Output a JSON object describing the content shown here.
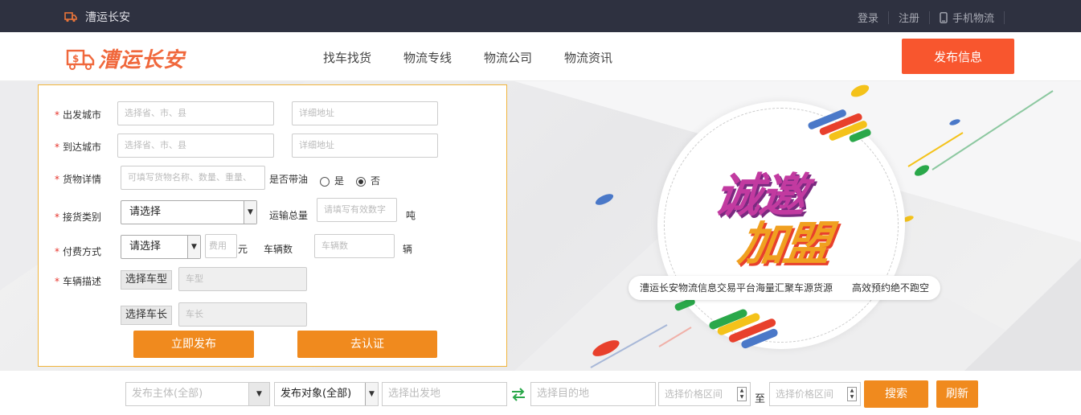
{
  "topbar": {
    "brand": "漕运长安",
    "login": "登录",
    "register": "注册",
    "mobile": "手机物流"
  },
  "header": {
    "logo_text": "漕运长安",
    "nav": [
      "找车找货",
      "物流专线",
      "物流公司",
      "物流资讯"
    ],
    "publish_button": "发布信息"
  },
  "form": {
    "depart_city_label": "出发城市",
    "arrive_city_label": "到达城市",
    "cargo_label": "货物详情",
    "receive_type_label": "接货类别",
    "payment_label": "付费方式",
    "vehicle_desc_label": "车辆描述",
    "region_placeholder": "选择省、市、县",
    "address_placeholder": "详细地址",
    "cargo_placeholder": "可填写货物名称、数量、重量、",
    "oil_label": "是否带油",
    "yes": "是",
    "no": "否",
    "oil_selected": "否",
    "receive_select": "请选择",
    "total_label": "运输总量",
    "total_placeholder": "请填写有效数字",
    "ton": "吨",
    "payment_select": "请选择",
    "fee_placeholder": "费用",
    "yuan": "元",
    "vehicle_count_label": "车辆数",
    "vehicle_count_placeholder": "车辆数",
    "vehicle_unit": "辆",
    "choose_type": "选择车型",
    "type_placeholder": "车型",
    "choose_length": "选择车长",
    "length_placeholder": "车长",
    "submit": "立即发布",
    "certify": "去认证"
  },
  "banner": {
    "art_line1": "诚邀",
    "art_line2": "加盟",
    "tagline_left": "漕运长安物流信息交易平台海量汇聚车源货源",
    "tagline_right": "高效预约绝不跑空"
  },
  "search": {
    "publisher": "发布主体(全部)",
    "target": "发布对象(全部)",
    "from_placeholder": "选择出发地",
    "to_placeholder": "选择目的地",
    "price_placeholder_1": "选择价格区间",
    "to_word": "至",
    "price_placeholder_2": "选择价格区间",
    "search_button": "搜索",
    "refresh_button": "刷新"
  },
  "colors": {
    "topbar": "#2e3140",
    "accent": "#f8562e",
    "orange_button": "#f08a1e",
    "form_border": "#f0b43c"
  }
}
